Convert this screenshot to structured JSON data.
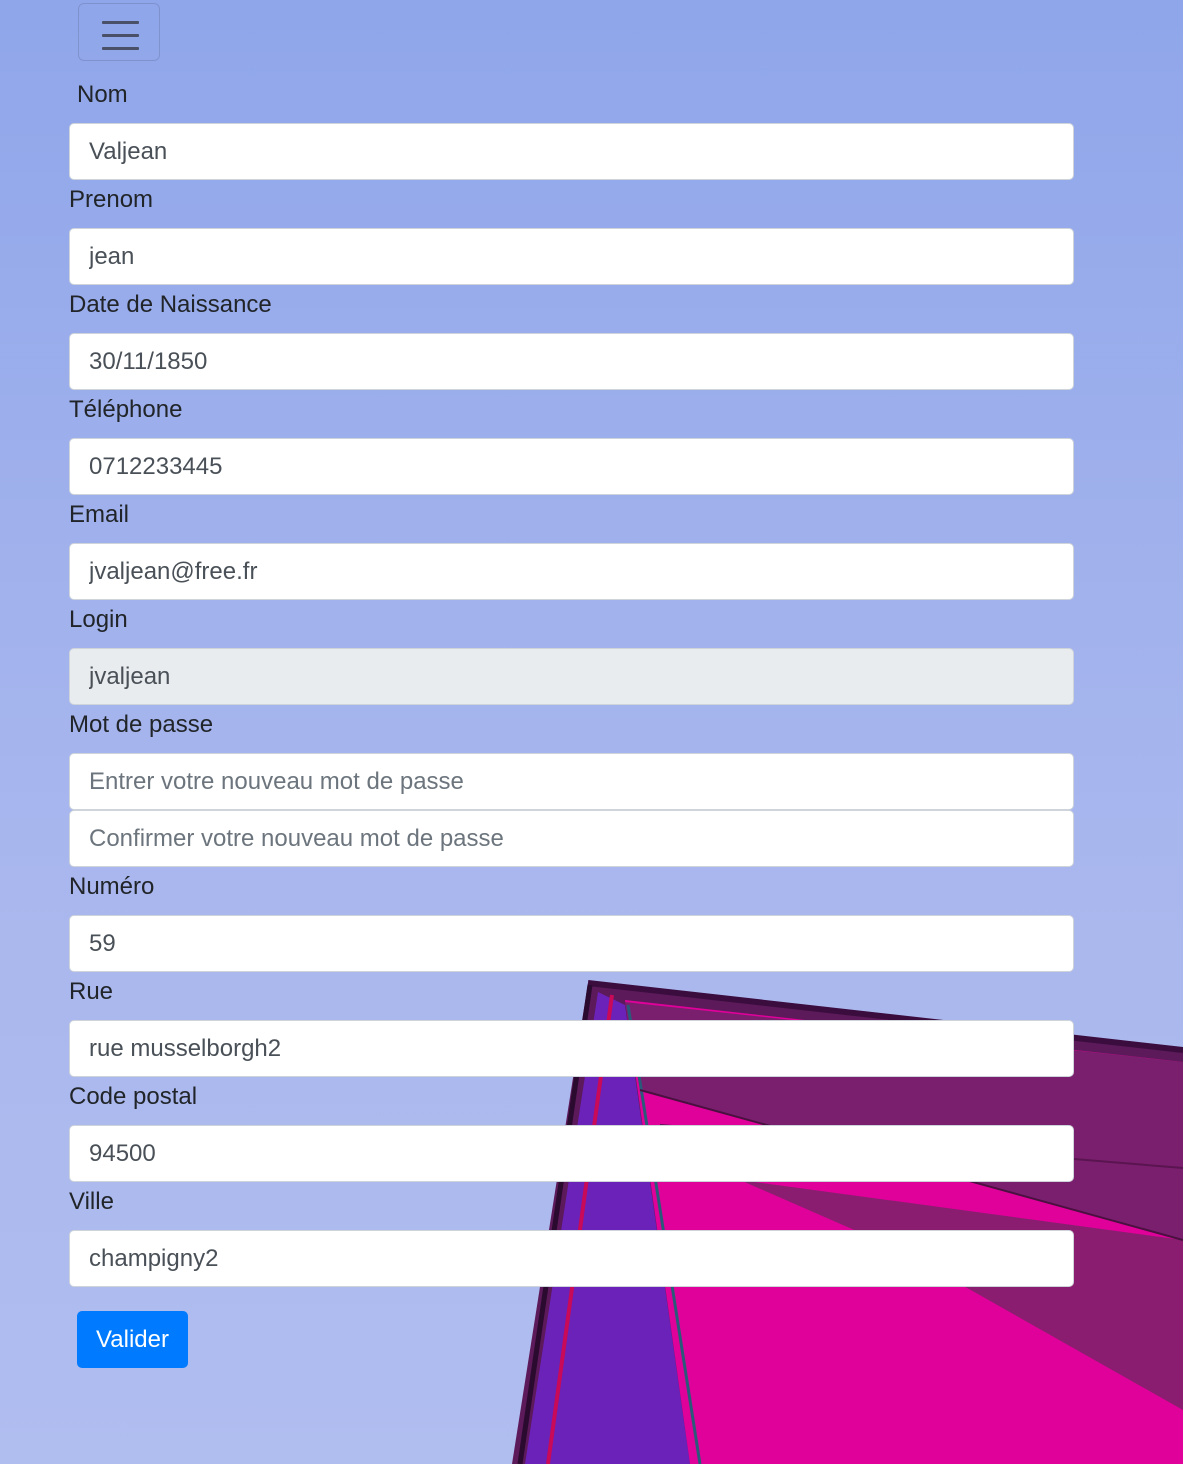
{
  "navbar": {
    "toggler_icon": "hamburger-icon"
  },
  "form": {
    "fields": [
      {
        "label": "Nom",
        "value": "Valjean",
        "placeholder": ""
      },
      {
        "label": "Prenom",
        "value": "jean",
        "placeholder": ""
      },
      {
        "label": "Date de Naissance",
        "value": "30/11/1850",
        "placeholder": ""
      },
      {
        "label": "Téléphone",
        "value": "0712233445",
        "placeholder": ""
      },
      {
        "label": "Email",
        "value": "jvaljean@free.fr",
        "placeholder": ""
      },
      {
        "label": "Login",
        "value": "jvaljean",
        "placeholder": "",
        "readonly": true
      },
      {
        "label": "Mot de passe",
        "value": "",
        "placeholder": "Entrer votre nouveau mot de passe",
        "confirm_placeholder": "Confirmer votre nouveau mot de passe"
      },
      {
        "label": "Numéro",
        "value": "59",
        "placeholder": ""
      },
      {
        "label": "Rue",
        "value": "rue musselborgh2",
        "placeholder": ""
      },
      {
        "label": "Code postal",
        "value": "94500",
        "placeholder": ""
      },
      {
        "label": "Ville",
        "value": "champigny2",
        "placeholder": ""
      }
    ],
    "submit_label": "Valider"
  },
  "colors": {
    "background": "#9fb0ec",
    "button": "#007bff",
    "readonly_field": "#e9ecef",
    "art_magenta": "#e0009a",
    "art_purple": "#7a1f6e"
  }
}
